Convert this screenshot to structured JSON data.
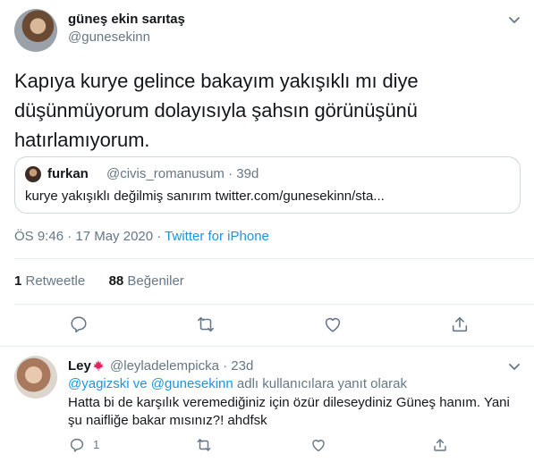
{
  "tweet": {
    "author_name": "güneş ekin sarıtaş",
    "author_handle": "@gunesekinn",
    "text": "Kapıya kurye gelince bakayım yakışıklı mı diye düşünmüyorum dolayısıyla şahsın görünüşünü hatırlamıyorum.",
    "timestamp": "ÖS 9:46 · 17 May 2020 · ",
    "source": "Twitter for iPhone",
    "retweets_count": "1",
    "retweets_label": " Retweetle",
    "likes_count": "88",
    "likes_label": " Beğeniler"
  },
  "quote": {
    "name": "furkan",
    "meta": "@civis_romanusum · 39d",
    "text": "kurye yakışıklı değilmiş sanırım twitter.com/gunesekinn/sta..."
  },
  "reply": {
    "name": "Ley",
    "meta": "@leyladelempicka · 23d",
    "mention_1": "@yagizski",
    "mention_joiner": " ve ",
    "mention_2": "@gunesekinn",
    "reply_to_suffix": " adlı kullanıcılara yanıt olarak",
    "text": "Hatta bi de karşılık veremediğiniz için özür dileseydiniz Güneş hanım. Yani şu naifliğe bakar mısınız?! ahdfsk",
    "reply_count": "1"
  },
  "icons": {
    "caret": "chevron-down-icon",
    "reply": "reply-icon",
    "retweet": "retweet-icon",
    "like": "heart-icon",
    "share": "share-icon",
    "flag": "maple-leaf-icon"
  },
  "colors": {
    "link": "#1b95e0",
    "secondary_text": "#657786",
    "divider": "#e6ecf0"
  }
}
